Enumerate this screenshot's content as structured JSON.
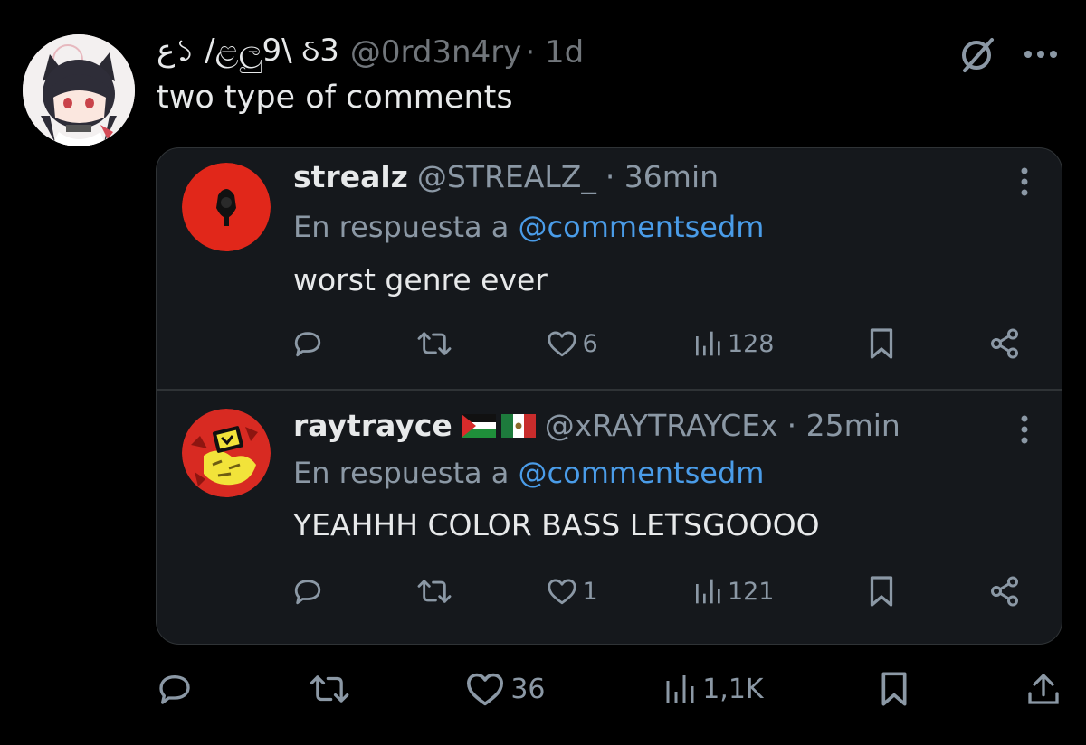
{
  "tweet": {
    "display_name": "ﻉ১ /ළලු9\\ ઠ3",
    "handle": "@0rd3n4ry",
    "time": "· 1d",
    "text": "two type of comments",
    "likes": "36",
    "views": "1,1K"
  },
  "quoted": {
    "comments": [
      {
        "name": "strealz",
        "handle": "@STREALZ_",
        "time": "· 36min",
        "reply_prefix": "En respuesta a ",
        "reply_to": "@commentsedm",
        "text": "worst genre ever",
        "likes": "6",
        "views": "128"
      },
      {
        "name": "raytrayce",
        "handle": "@xRAYTRAYCEx",
        "time": "· 25min",
        "reply_prefix": "En respuesta a ",
        "reply_to": "@commentsedm",
        "text": "YEAHHH COLOR BASS LETSGOOOO",
        "likes": "1",
        "views": "121"
      }
    ]
  },
  "icons": [
    "grok-icon",
    "more-icon",
    "reply-icon",
    "retweet-icon",
    "like-icon",
    "views-icon",
    "bookmark-icon",
    "share-icon"
  ],
  "colors": {
    "background": "#000000",
    "card": "#15181c",
    "text": "#e7e9ea",
    "muted": "#71767b",
    "link": "#4a9ce8"
  }
}
